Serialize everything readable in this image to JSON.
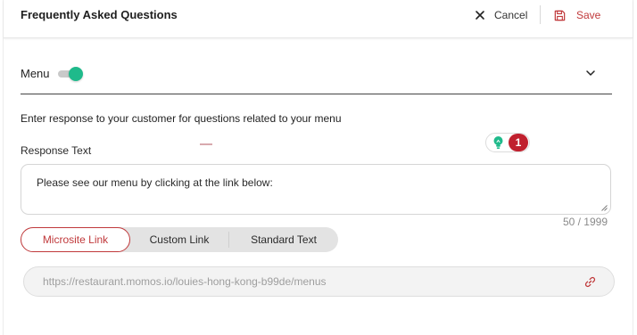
{
  "header": {
    "title": "Frequently Asked Questions",
    "cancel_label": "Cancel",
    "save_label": "Save"
  },
  "menu_section": {
    "label": "Menu",
    "toggle_on": true,
    "description": "Enter response to your customer for questions related to your menu"
  },
  "response": {
    "label": "Response Text",
    "value": "Please see our menu by clicking at the link below:",
    "counter": "50 / 1999",
    "assist_badge_count": "1"
  },
  "link_types": {
    "options": [
      "Microsite Link",
      "Custom Link",
      "Standard Text"
    ],
    "selected": "Microsite Link"
  },
  "link_input": {
    "value": "https://restaurant.momos.io/louies-hong-kong-b99de/menus"
  },
  "colors": {
    "accent_red": "#c0393b",
    "toggle_green": "#1fba8b",
    "badge_red": "#c0202e"
  },
  "icons": [
    "close-icon",
    "save-disk-icon",
    "chevron-down-icon",
    "lightbulb-icon",
    "resize-handle-icon",
    "link-chain-icon"
  ]
}
